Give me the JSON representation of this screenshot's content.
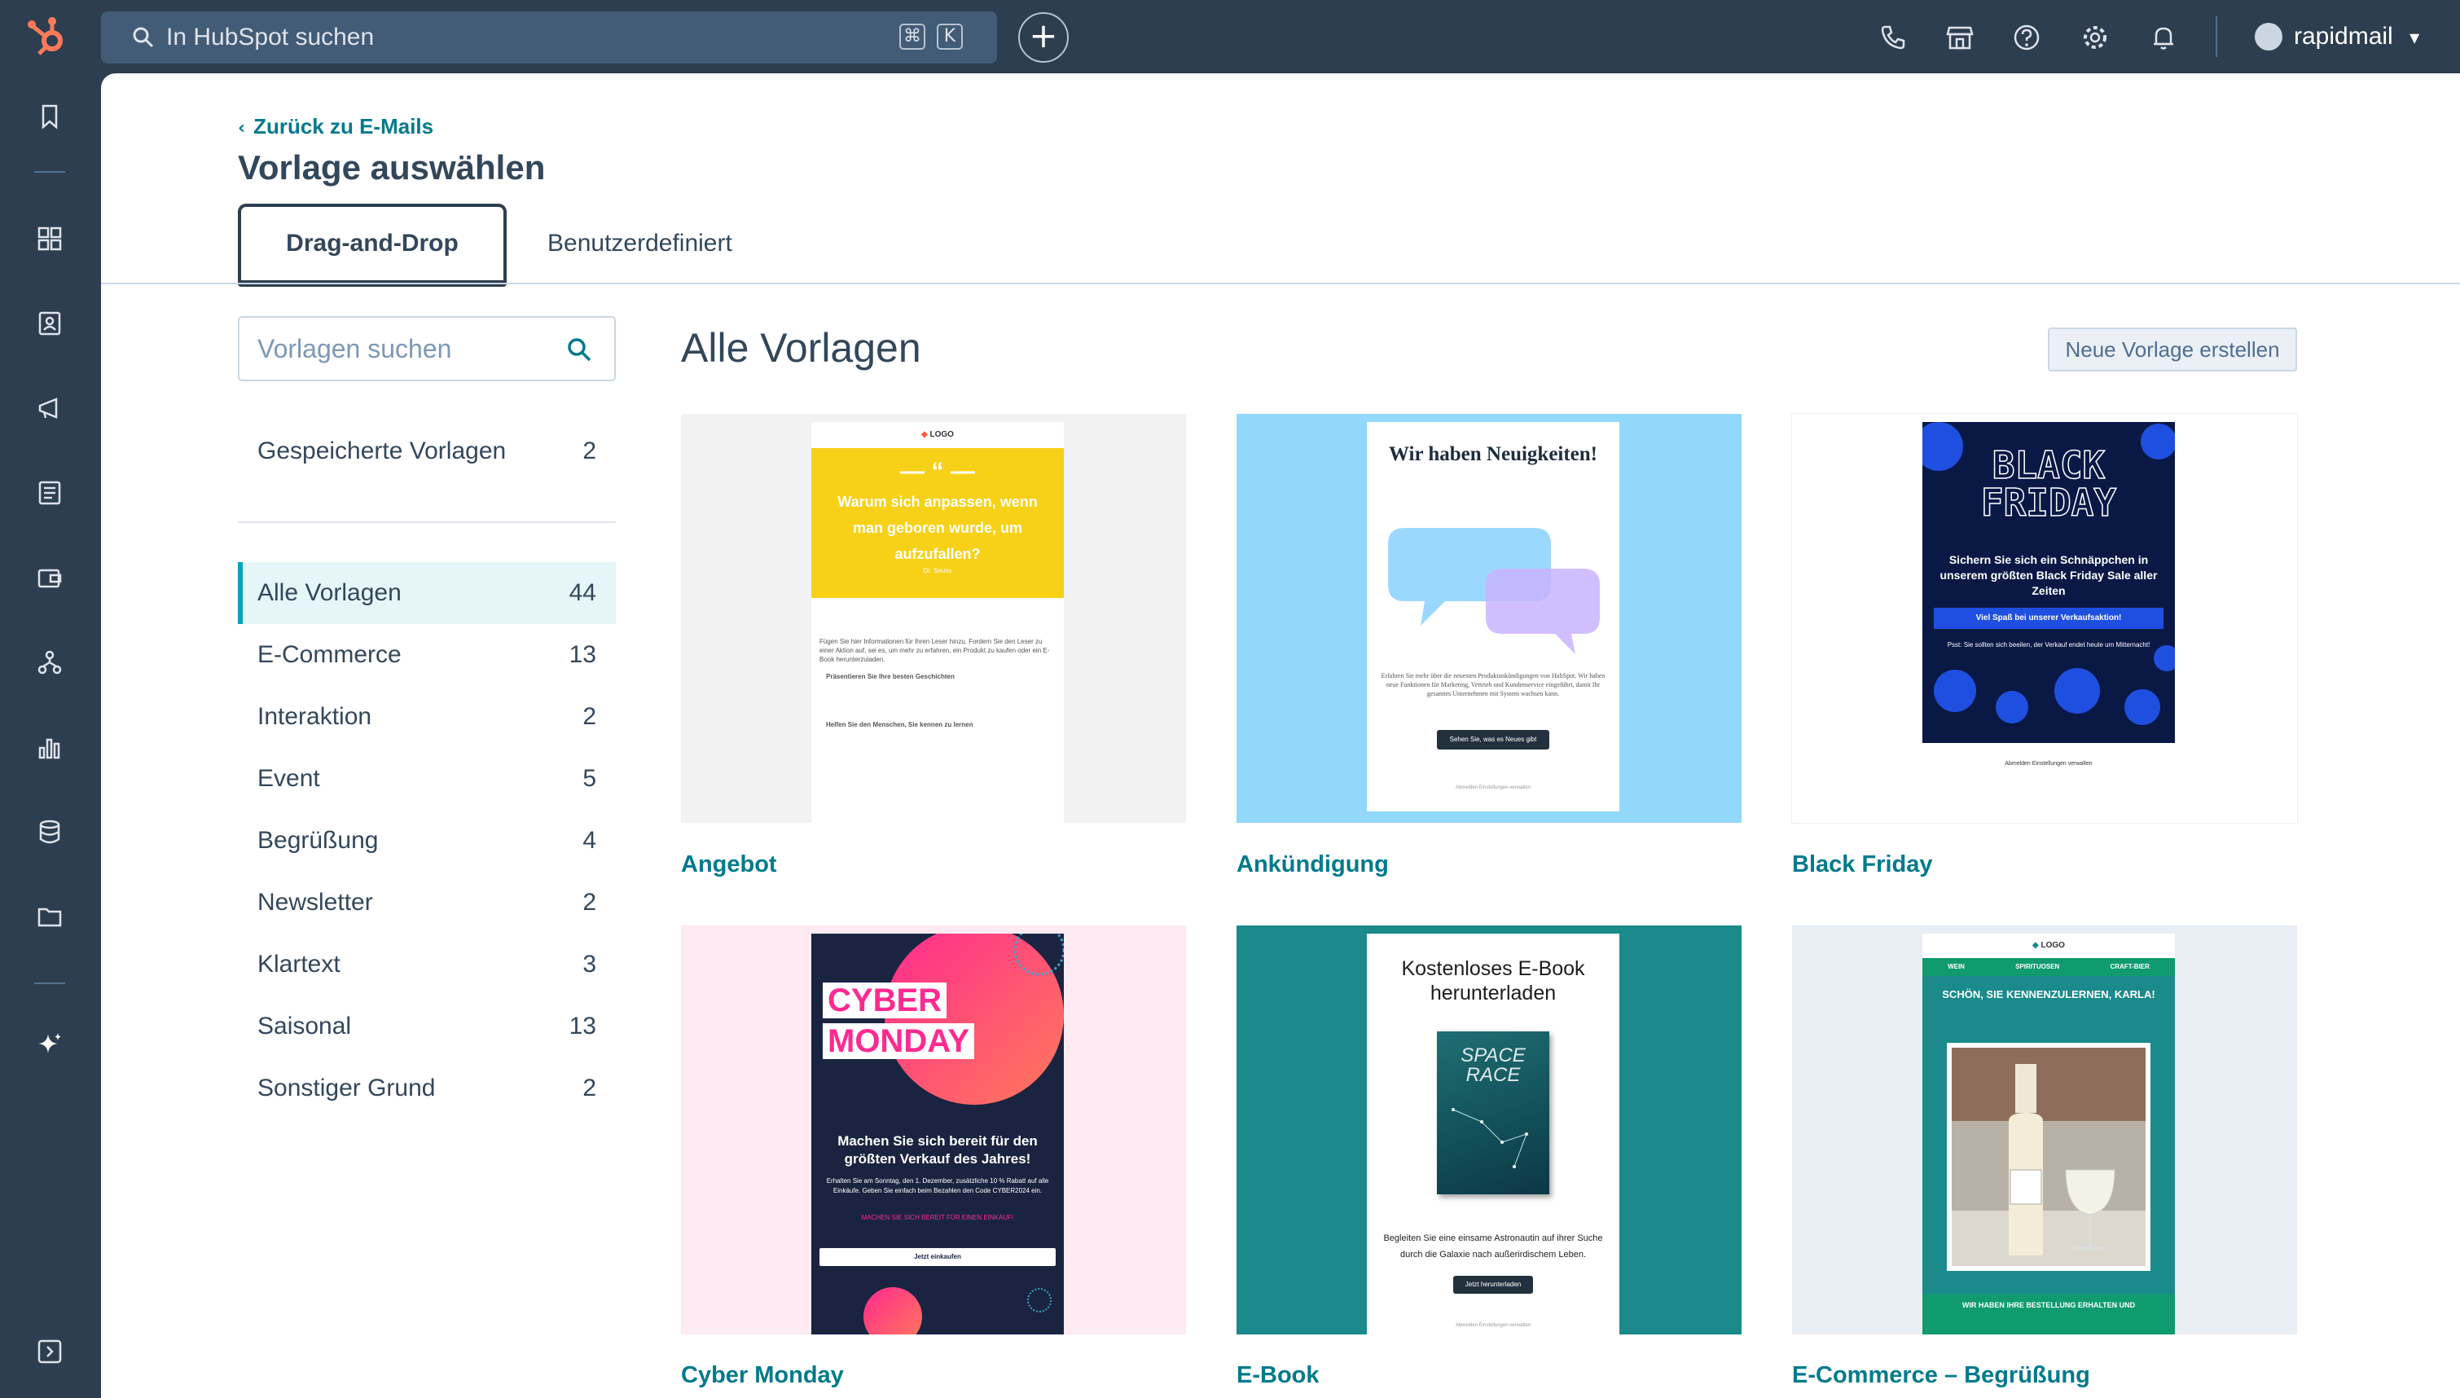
{
  "topbar": {
    "search_placeholder": "In HubSpot suchen",
    "kbd_cmd": "⌘",
    "kbd_k": "K",
    "plus_label": "+",
    "user_name": "rapidmail",
    "user_caret": "▾"
  },
  "page": {
    "back_link": "Zurück zu E-Mails",
    "title": "Vorlage auswählen",
    "tabs": [
      {
        "label": "Drag-and-Drop",
        "active": true
      },
      {
        "label": "Benutzerdefiniert",
        "active": false
      }
    ]
  },
  "filters": {
    "search_placeholder": "Vorlagen suchen",
    "saved": {
      "label": "Gespeicherte Vorlagen",
      "count": "2"
    },
    "categories": [
      {
        "label": "Alle Vorlagen",
        "count": "44",
        "active": true
      },
      {
        "label": "E-Commerce",
        "count": "13"
      },
      {
        "label": "Interaktion",
        "count": "2"
      },
      {
        "label": "Event",
        "count": "5"
      },
      {
        "label": "Begrüßung",
        "count": "4"
      },
      {
        "label": "Newsletter",
        "count": "2"
      },
      {
        "label": "Klartext",
        "count": "3"
      },
      {
        "label": "Saisonal",
        "count": "13"
      },
      {
        "label": "Sonstiger Grund",
        "count": "2"
      }
    ]
  },
  "gallery": {
    "heading": "Alle Vorlagen",
    "new_button": "Neue Vorlage erstellen",
    "templates": [
      {
        "name": "Angebot",
        "preview": {
          "logo": "LOGO",
          "quote": "Warum sich anpassen, wenn man geboren wurde, um aufzufallen?",
          "author": "Dr. Seuss",
          "body": "Fügen Sie hier Informationen für Ihren Leser hinzu. Fordern Sie den Leser zu einer Aktion auf, sei es, um mehr zu erfahren, ein Produkt zu kaufen oder ein E-Book herunterzuladen.",
          "bullet1": "Präsentieren Sie Ihre besten Geschichten",
          "bullet2": "Helfen Sie den Menschen, Sie kennen zu lernen"
        }
      },
      {
        "name": "Ankündigung",
        "preview": {
          "headline": "Wir haben Neuigkeiten!",
          "body": "Erfahren Sie mehr über die neuesten Produktankündigungen von HubSpot. Wir haben neue Funktionen für Marketing, Vertrieb und Kundenservice eingeführt, damit Ihr gesamtes Unternehmen mit System wachsen kann.",
          "button": "Sehen Sie, was es Neues gibt",
          "footer": "Abmelden  Einstellungen verwalten"
        }
      },
      {
        "name": "Black Friday",
        "preview": {
          "headline_line1": "BLACK",
          "headline_line2": "FRIDAY",
          "body": "Sichern Sie sich ein Schnäppchen in unserem größten Black Friday Sale aller Zeiten",
          "button": "Viel Spaß bei unserer Verkaufsaktion!",
          "note": "Psst: Sie sollten sich beeilen, der Verkauf endet heute um Mitternacht!",
          "footer": "Abmelden  Einstellungen verwalten"
        }
      },
      {
        "name": "Cyber Monday",
        "preview": {
          "headline_line1": "CYBER",
          "headline_line2": "MONDAY",
          "body": "Machen Sie sich bereit für den größten Verkauf des Jahres!",
          "small": "Erhalten Sie am Sonntag, den 1. Dezember, zusätzliche 10 % Rabatt auf alle Einkäufe. Geben Sie einfach beim Bezahlen den Code CYBER2024 ein.",
          "highlight": "MACHEN SIE SICH BEREIT FÜR EINEN EINKAUF!",
          "button": "Jetzt einkaufen"
        }
      },
      {
        "name": "E-Book",
        "preview": {
          "headline": "Kostenloses E-Book herunterladen",
          "book_title": "SPACE RACE",
          "body": "Begleiten Sie eine einsame Astronautin auf ihrer Suche durch die Galaxie nach außerirdischem Leben.",
          "button": "Jetzt herunterladen",
          "footer": "Abmelden  Einstellungen verwalten"
        }
      },
      {
        "name": "E-Commerce – Begrüßung",
        "preview": {
          "logo": "LOGO",
          "nav": [
            "WEIN",
            "SPIRITUOSEN",
            "CRAFT-BIER"
          ],
          "headline": "SCHÖN, SIE KENNENZULERNEN, KARLA!",
          "footer_text": "WIR HABEN IHRE BESTELLUNG ERHALTEN UND"
        }
      }
    ]
  },
  "colors": {
    "nav_dark": "#2d3e50",
    "accent_teal": "#007a8c",
    "hubspot_orange": "#ff7a59"
  }
}
